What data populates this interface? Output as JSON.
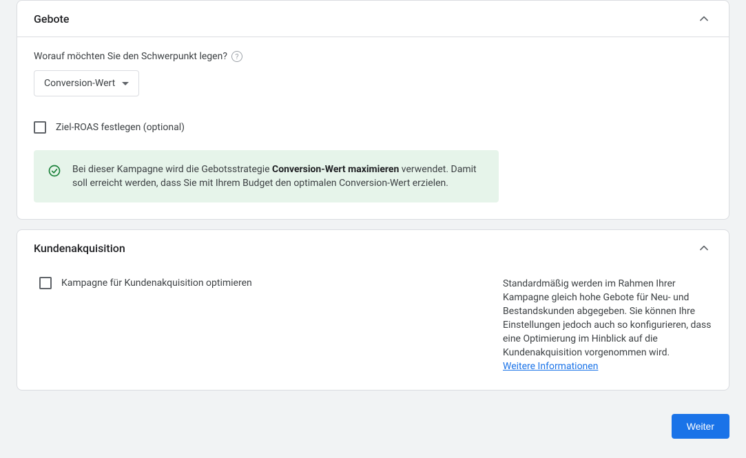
{
  "sections": {
    "bidding": {
      "title": "Gebote",
      "focus_label": "Worauf möchten Sie den Schwerpunkt legen?",
      "focus_value": "Conversion-Wert",
      "target_roas_label": "Ziel-ROAS festlegen (optional)",
      "info_prefix": "Bei dieser Kampagne wird die Gebotsstrategie ",
      "info_strategy": "Conversion-Wert maximieren",
      "info_suffix": " verwendet. Damit soll erreicht werden, dass Sie mit Ihrem Budget den optimalen Conversion-Wert erzielen."
    },
    "acquisition": {
      "title": "Kundenakquisition",
      "optimize_label": "Kampagne für Kundenakquisition optimieren",
      "description": "Standardmäßig werden im Rahmen Ihrer Kampagne gleich hohe Gebote für Neu- und Bestandskunden abgegeben. Sie können Ihre Einstellungen jedoch auch so konfigurieren, dass eine Optimierung im Hinblick auf die Kundenakquisition vorgenommen wird.",
      "learn_more": "Weitere Informationen"
    }
  },
  "footer": {
    "next": "Weiter"
  },
  "colors": {
    "accent": "#1a73e8",
    "success_bg": "#e6f4ea",
    "success_fg": "#188038"
  }
}
